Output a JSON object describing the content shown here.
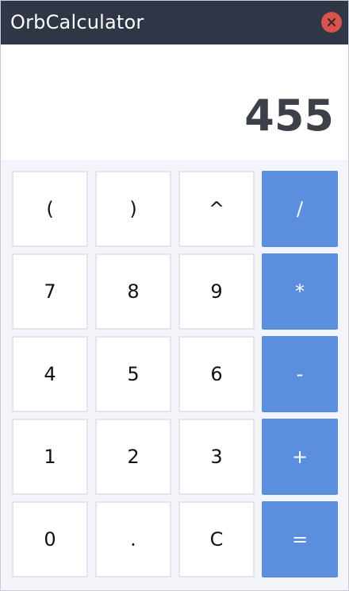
{
  "window": {
    "title": "OrbCalculator",
    "close_icon": "close-icon",
    "titlebar_color": "#2f3645",
    "close_color": "#d9534f"
  },
  "display": {
    "value": "455"
  },
  "keypad": {
    "accent_color": "#5b8fde",
    "rows": [
      [
        "(",
        ")",
        "^",
        "/"
      ],
      [
        "7",
        "8",
        "9",
        "*"
      ],
      [
        "4",
        "5",
        "6",
        "-"
      ],
      [
        "1",
        "2",
        "3",
        "+"
      ],
      [
        "0",
        ".",
        "C",
        "="
      ]
    ]
  }
}
